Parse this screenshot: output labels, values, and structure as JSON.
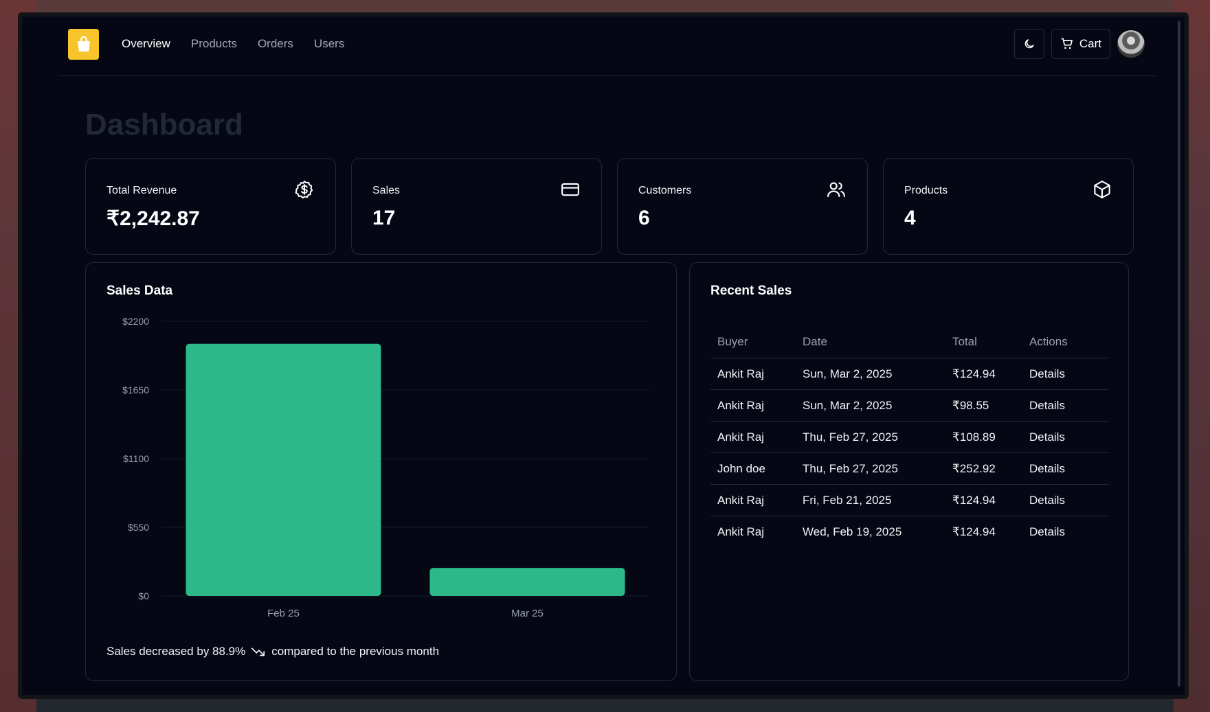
{
  "nav": {
    "links": [
      "Overview",
      "Products",
      "Orders",
      "Users"
    ],
    "active_index": 0
  },
  "header": {
    "cart_label": "Cart",
    "theme_icon": "moon-icon",
    "cart_icon": "cart-icon",
    "logo_icon": "shopping-bag-icon"
  },
  "page": {
    "title": "Dashboard"
  },
  "stats": [
    {
      "label": "Total Revenue",
      "value": "₹2,242.87",
      "icon": "dollar-circle-icon"
    },
    {
      "label": "Sales",
      "value": "17",
      "icon": "credit-card-icon"
    },
    {
      "label": "Customers",
      "value": "6",
      "icon": "users-icon"
    },
    {
      "label": "Products",
      "value": "4",
      "icon": "box-icon"
    }
  ],
  "sales_panel": {
    "title": "Sales Data",
    "note_before": "Sales decreased by 88.9%",
    "note_after": "compared to the previous month",
    "trend_icon": "trending-down-icon"
  },
  "chart_data": {
    "type": "bar",
    "categories": [
      "Feb 25",
      "Mar 25"
    ],
    "values": [
      2020,
      225
    ],
    "y_ticks": [
      "$2200",
      "$1650",
      "$1100",
      "$550",
      "$0"
    ],
    "ylim": [
      0,
      2200
    ],
    "grid": true,
    "bar_color": "#2db88a"
  },
  "recent_sales": {
    "title": "Recent Sales",
    "columns": [
      "Buyer",
      "Date",
      "Total",
      "Actions"
    ],
    "rows": [
      {
        "buyer": "Ankit Raj",
        "date": "Sun, Mar 2, 2025",
        "total": "₹124.94",
        "action": "Details"
      },
      {
        "buyer": "Ankit Raj",
        "date": "Sun, Mar 2, 2025",
        "total": "₹98.55",
        "action": "Details"
      },
      {
        "buyer": "Ankit Raj",
        "date": "Thu, Feb 27, 2025",
        "total": "₹108.89",
        "action": "Details"
      },
      {
        "buyer": "John doe",
        "date": "Thu, Feb 27, 2025",
        "total": "₹252.92",
        "action": "Details"
      },
      {
        "buyer": "Ankit Raj",
        "date": "Fri, Feb 21, 2025",
        "total": "₹124.94",
        "action": "Details"
      },
      {
        "buyer": "Ankit Raj",
        "date": "Wed, Feb 19, 2025",
        "total": "₹124.94",
        "action": "Details"
      }
    ]
  },
  "colors": {
    "accent": "#2db88a",
    "logo": "#f7c52b",
    "background": "#050814",
    "border": "#232838"
  }
}
